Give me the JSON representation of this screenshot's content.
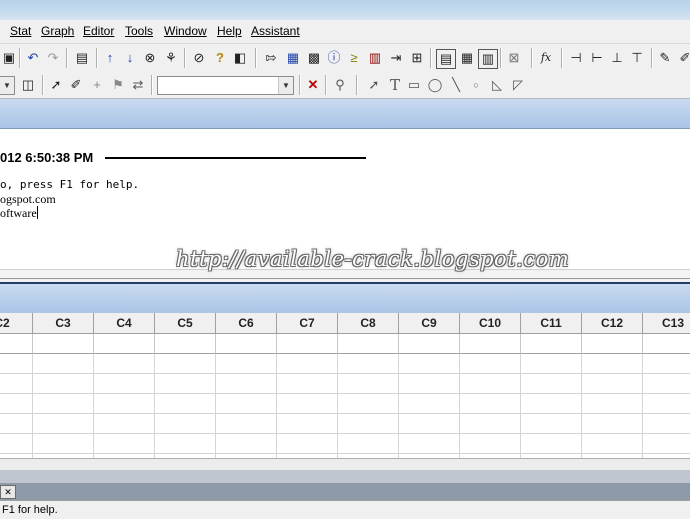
{
  "menu": {
    "stat": "Stat",
    "graph": "Graph",
    "editor": "Editor",
    "tools": "Tools",
    "window": "Window",
    "help": "Help",
    "assistant": "Assistant"
  },
  "toolbar": {
    "fx_label": "fx"
  },
  "session": {
    "date_fragment": "012 6:50:38 PM",
    "line1": "o, press F1 for help.",
    "line2": "ogspot.com",
    "line3": "oftware"
  },
  "worksheet": {
    "columns": [
      "C2",
      "C3",
      "C4",
      "C5",
      "C6",
      "C7",
      "C8",
      "C9",
      "C10",
      "C11",
      "C12",
      "C13"
    ]
  },
  "tabbar": {
    "close_glyph": "✕"
  },
  "status": {
    "text": "F1 for help."
  },
  "watermark": "http://available-crack.blogspot.com"
}
